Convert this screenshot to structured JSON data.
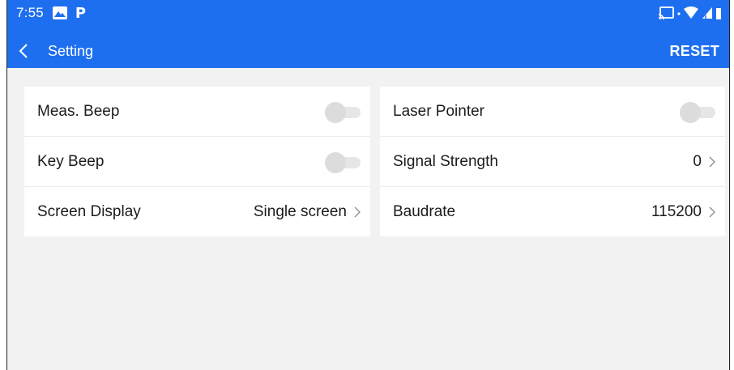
{
  "status_bar": {
    "time": "7:55",
    "icons": [
      "gallery-icon",
      "p-icon",
      "cast-icon",
      "wifi-icon",
      "signal-icon",
      "battery-icon"
    ],
    "p_label": "P"
  },
  "toolbar": {
    "title": "Setting",
    "reset_label": "RESET",
    "accent_color": "#1e6ff0"
  },
  "left_panel": {
    "items": [
      {
        "label": "Meas. Beep",
        "type": "toggle",
        "on": false
      },
      {
        "label": "Key Beep",
        "type": "toggle",
        "on": false
      },
      {
        "label": "Screen Display",
        "type": "value",
        "value": "Single screen"
      }
    ]
  },
  "right_panel": {
    "items": [
      {
        "label": "Laser Pointer",
        "type": "toggle",
        "on": false
      },
      {
        "label": "Signal Strength",
        "type": "value",
        "value": "0"
      },
      {
        "label": "Baudrate",
        "type": "value",
        "value": "115200"
      }
    ]
  }
}
